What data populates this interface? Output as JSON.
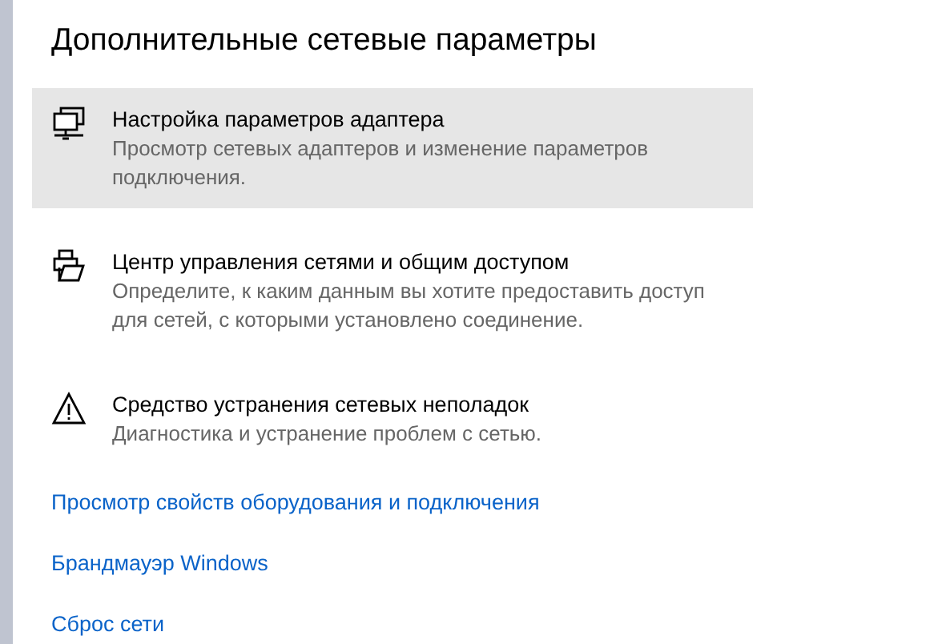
{
  "title": "Дополнительные сетевые параметры",
  "items": [
    {
      "kind": "adapter",
      "title": "Настройка параметров адаптера",
      "description": "Просмотр сетевых адаптеров и изменение параметров подключения.",
      "selected": true
    },
    {
      "kind": "sharing",
      "title": "Центр управления сетями и общим доступом",
      "description": "Определите, к каким данным вы хотите предоставить доступ для сетей, с которыми установлено соединение.",
      "selected": false
    },
    {
      "kind": "troubleshoot",
      "title": "Средство устранения сетевых неполадок",
      "description": "Диагностика и устранение проблем с сетью.",
      "selected": false
    }
  ],
  "links": [
    "Просмотр свойств оборудования и подключения",
    "Брандмауэр Windows",
    "Сброс сети"
  ]
}
